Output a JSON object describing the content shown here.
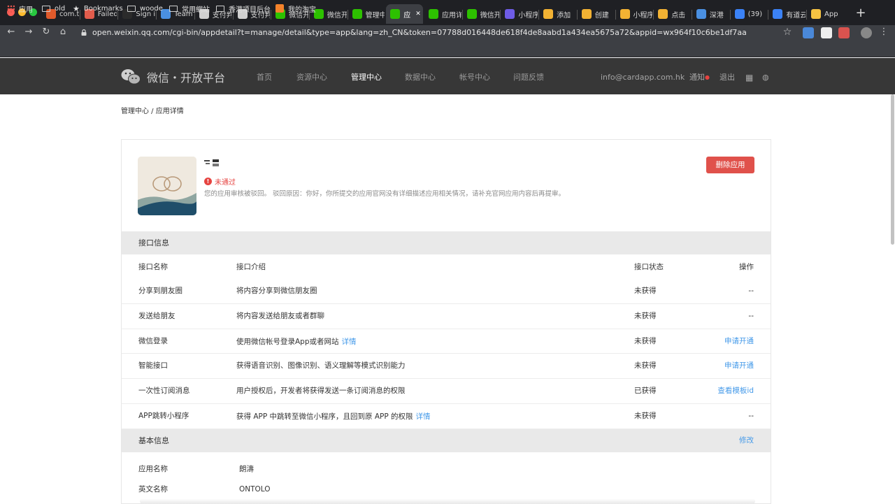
{
  "browser": {
    "tabs": [
      {
        "label": "com.t",
        "icon": "s-icon",
        "color": "#e05a2b"
      },
      {
        "label": "Failed",
        "icon": "failed-icon",
        "color": "#e25c4c"
      },
      {
        "label": "Sign i",
        "icon": "tumblr-icon",
        "color": "#2b2b2b"
      },
      {
        "label": "Team",
        "icon": "team-icon",
        "color": "#4a90e2"
      },
      {
        "label": "支付判",
        "icon": "pay-icon",
        "color": "#d0d0d0"
      },
      {
        "label": "支付判",
        "icon": "pay-icon",
        "color": "#d0d0d0"
      },
      {
        "label": "微信开",
        "icon": "wechat-icon",
        "color": "#2dc100"
      },
      {
        "label": "微信开",
        "icon": "wechat-icon",
        "color": "#2dc100"
      },
      {
        "label": "管理中",
        "icon": "wechat-icon",
        "color": "#2dc100"
      },
      {
        "label": "应",
        "icon": "wechat-icon",
        "color": "#2dc100"
      },
      {
        "label": "应用详",
        "icon": "wechat-icon",
        "color": "#2dc100"
      },
      {
        "label": "微信开",
        "icon": "wechat-icon",
        "color": "#2dc100"
      },
      {
        "label": "小程序",
        "icon": "miniapp-icon",
        "color": "#6e5ce6"
      },
      {
        "label": "添加",
        "icon": "grid-icon",
        "color": "#f2b233"
      },
      {
        "label": "创建",
        "icon": "grid-icon",
        "color": "#f2b233"
      },
      {
        "label": "小程序",
        "icon": "grid-icon",
        "color": "#f2b233"
      },
      {
        "label": "点击",
        "icon": "grid-icon",
        "color": "#f2b233"
      },
      {
        "label": "深港",
        "icon": "globe-icon",
        "color": "#4a90e2"
      },
      {
        "label": "(39)",
        "icon": "bookmark-icon",
        "color": "#3b82f6"
      },
      {
        "label": "有道云",
        "icon": "youdao-icon",
        "color": "#3b82f6"
      },
      {
        "label": "App",
        "icon": "f-icon",
        "color": "#f5c242"
      }
    ],
    "url": "open.weixin.qq.com/cgi-bin/appdetail?t=manage/detail&type=app&lang=zh_CN&token=07788d016448de618f4de8aabd1a434ea5675a72&appid=wx964f10c6be1df7aa",
    "bookmarks": [
      "应用",
      "old",
      "Bookmarks",
      "woode",
      "常用網站",
      "香港项目后台",
      "我的淘宝"
    ]
  },
  "header": {
    "logo_text": "微信・开放平台",
    "nav": [
      "首页",
      "资源中心",
      "管理中心",
      "数据中心",
      "帐号中心",
      "问题反馈"
    ],
    "email": "info@cardapp.com.hk",
    "notify": "通知",
    "logout": "退出"
  },
  "breadcrumb": "管理中心 / 应用详情",
  "app": {
    "status": "未通过",
    "reason": "您的应用审核被驳回。 驳回原因：你好，你所提交的应用官网没有详细描述应用相关情况，请补充官网应用内容后再提审。",
    "delete_label": "删除应用"
  },
  "interface_section": {
    "title": "接口信息",
    "headers": [
      "接口名称",
      "接口介绍",
      "接口状态",
      "操作"
    ],
    "rows": [
      {
        "name": "分享到朋友圈",
        "desc": "将内容分享到微信朋友圈",
        "link": "",
        "state": "未获得",
        "action": "--"
      },
      {
        "name": "发送给朋友",
        "desc": "将内容发送给朋友或者群聊",
        "link": "",
        "state": "未获得",
        "action": "--"
      },
      {
        "name": "微信登录",
        "desc": "使用微信帐号登录App或者网站",
        "link": "详情",
        "state": "未获得",
        "action": "申请开通"
      },
      {
        "name": "智能接口",
        "desc": "获得语音识别、图像识别、语义理解等模式识别能力",
        "link": "",
        "state": "未获得",
        "action": "申请开通"
      },
      {
        "name": "一次性订阅消息",
        "desc": "用户授权后，开发者将获得发送一条订阅消息的权限",
        "link": "",
        "state": "已获得",
        "action": "查看模板id"
      },
      {
        "name": "APP跳转小程序",
        "desc": "获得 APP 中跳转至微信小程序，且回到原 APP 的权限",
        "link": "详情",
        "state": "未获得",
        "action": "--"
      }
    ]
  },
  "basic_section": {
    "title": "基本信息",
    "edit": "修改",
    "fields": [
      {
        "label": "应用名称",
        "value": "朗濤"
      },
      {
        "label": "英文名称",
        "value": "ONTOLO"
      }
    ]
  }
}
